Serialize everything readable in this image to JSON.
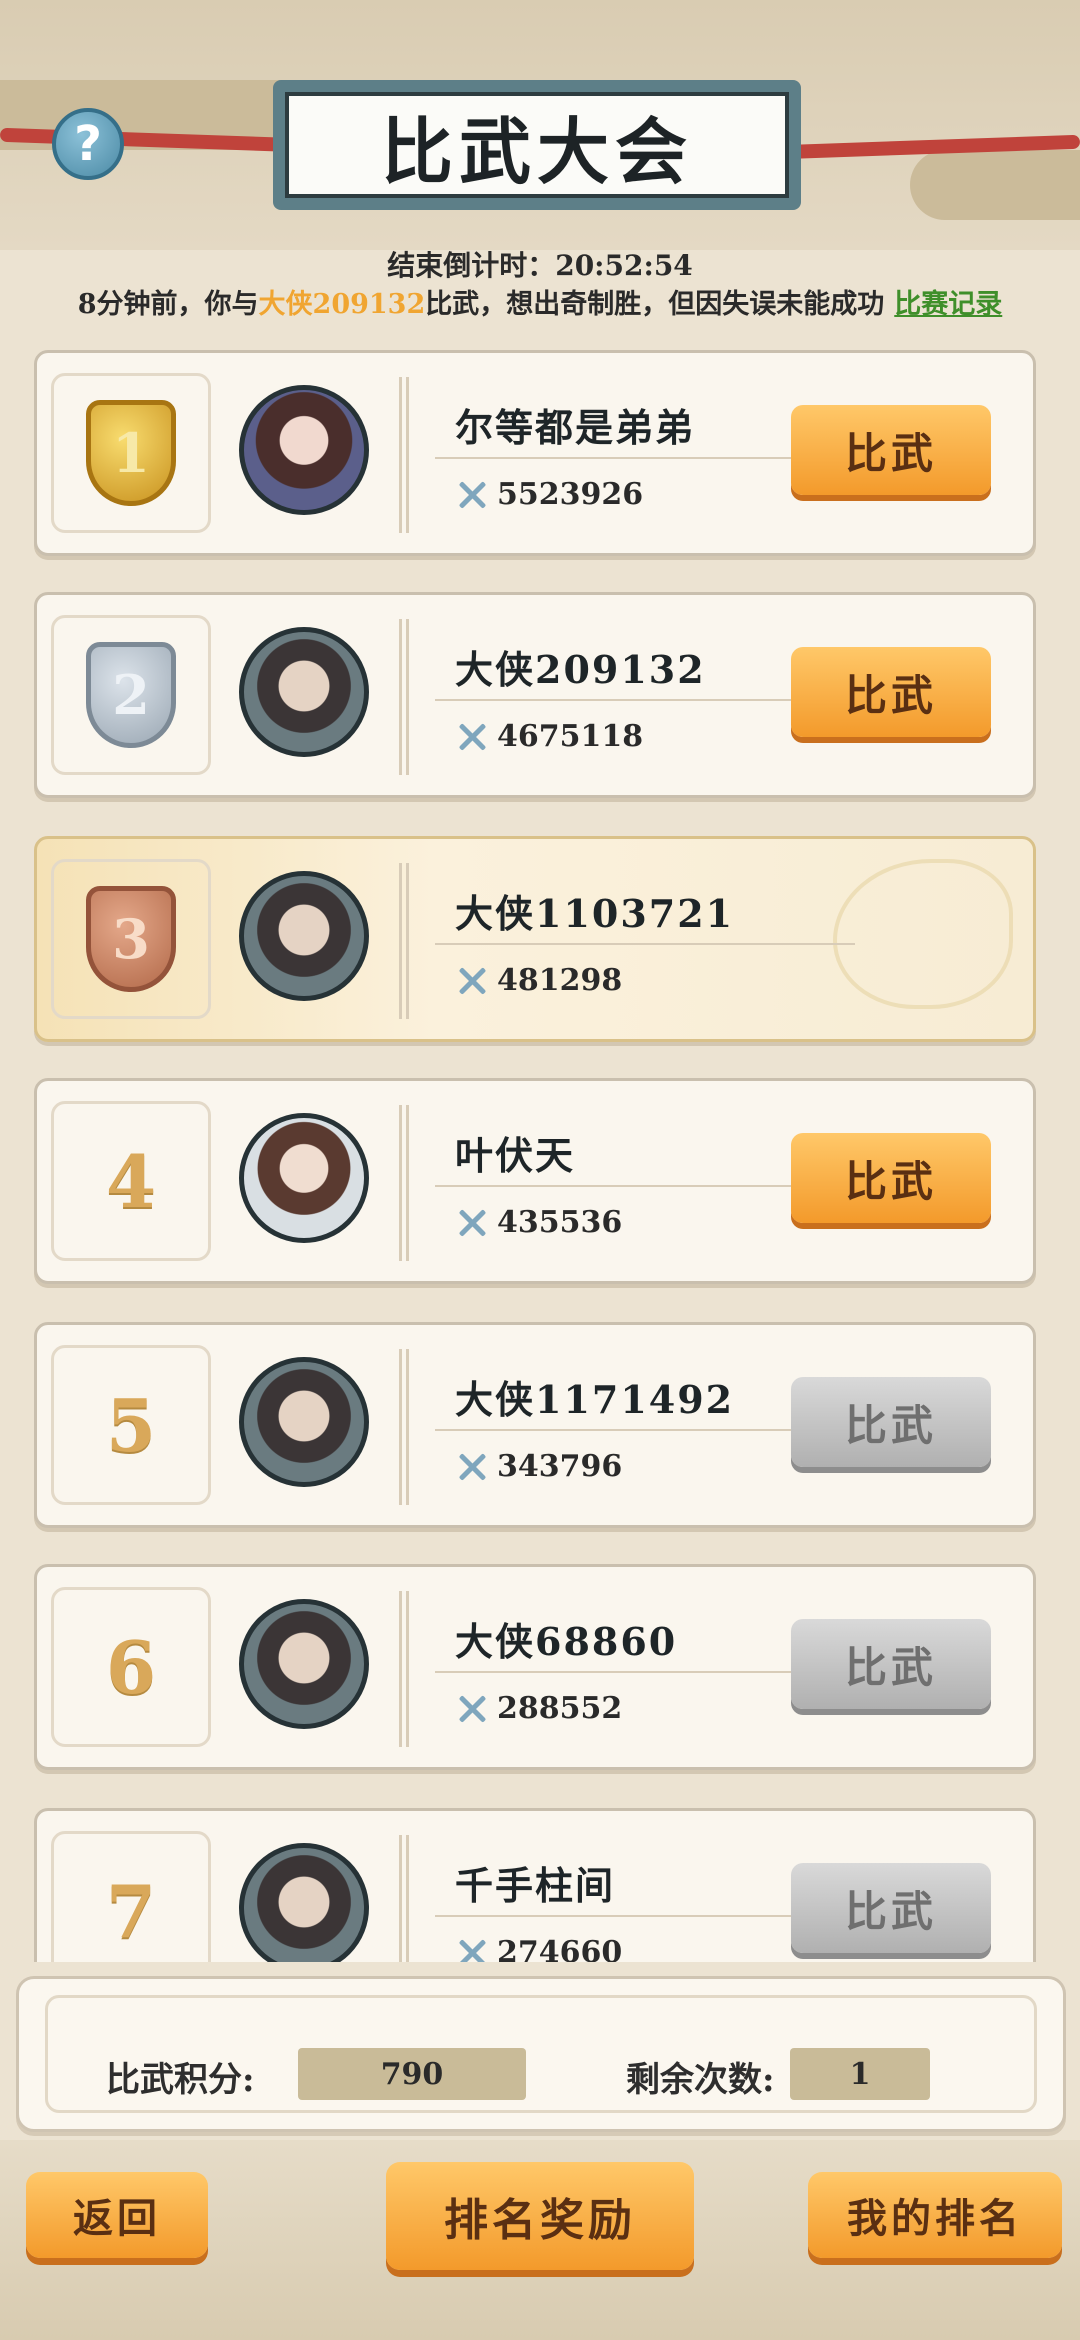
{
  "header": {
    "title": "比武大会",
    "help_symbol": "?"
  },
  "countdown": {
    "label": "结束倒计时：",
    "time": "20:52:54"
  },
  "notice": {
    "prefix": "8分钟前，你与",
    "opponent": "大侠209132",
    "suffix": "比武，想出奇制胜，但因失误未能成功",
    "record_link": "比赛记录"
  },
  "ranking": [
    {
      "rank": "1",
      "name": "尔等都是弟弟",
      "power": "5523926",
      "button": "比武",
      "button_state": "active",
      "medal": "gold"
    },
    {
      "rank": "2",
      "name": "大侠209132",
      "power": "4675118",
      "button": "比武",
      "button_state": "active",
      "medal": "silver"
    },
    {
      "rank": "3",
      "name": "大侠1103721",
      "power": "481298",
      "button": "",
      "button_state": "self",
      "medal": "bronze"
    },
    {
      "rank": "4",
      "name": "叶伏天",
      "power": "435536",
      "button": "比武",
      "button_state": "active"
    },
    {
      "rank": "5",
      "name": "大侠1171492",
      "power": "343796",
      "button": "比武",
      "button_state": "disabled"
    },
    {
      "rank": "6",
      "name": "大侠68860",
      "power": "288552",
      "button": "比武",
      "button_state": "disabled"
    },
    {
      "rank": "7",
      "name": "千手柱间",
      "power": "274660",
      "button": "比武",
      "button_state": "disabled"
    }
  ],
  "stats": {
    "score_label": "比武积分:",
    "score_value": "790",
    "remaining_label": "剩余次数:",
    "remaining_value": "1"
  },
  "footer": {
    "back": "返回",
    "rank_reward": "排名奖励",
    "my_rank": "我的排名"
  },
  "colors": {
    "accent_orange": "#f39a2b",
    "highlight_name": "#f0a531",
    "link_green": "#3f8f2a",
    "disabled_gray": "#b0b0b0"
  }
}
